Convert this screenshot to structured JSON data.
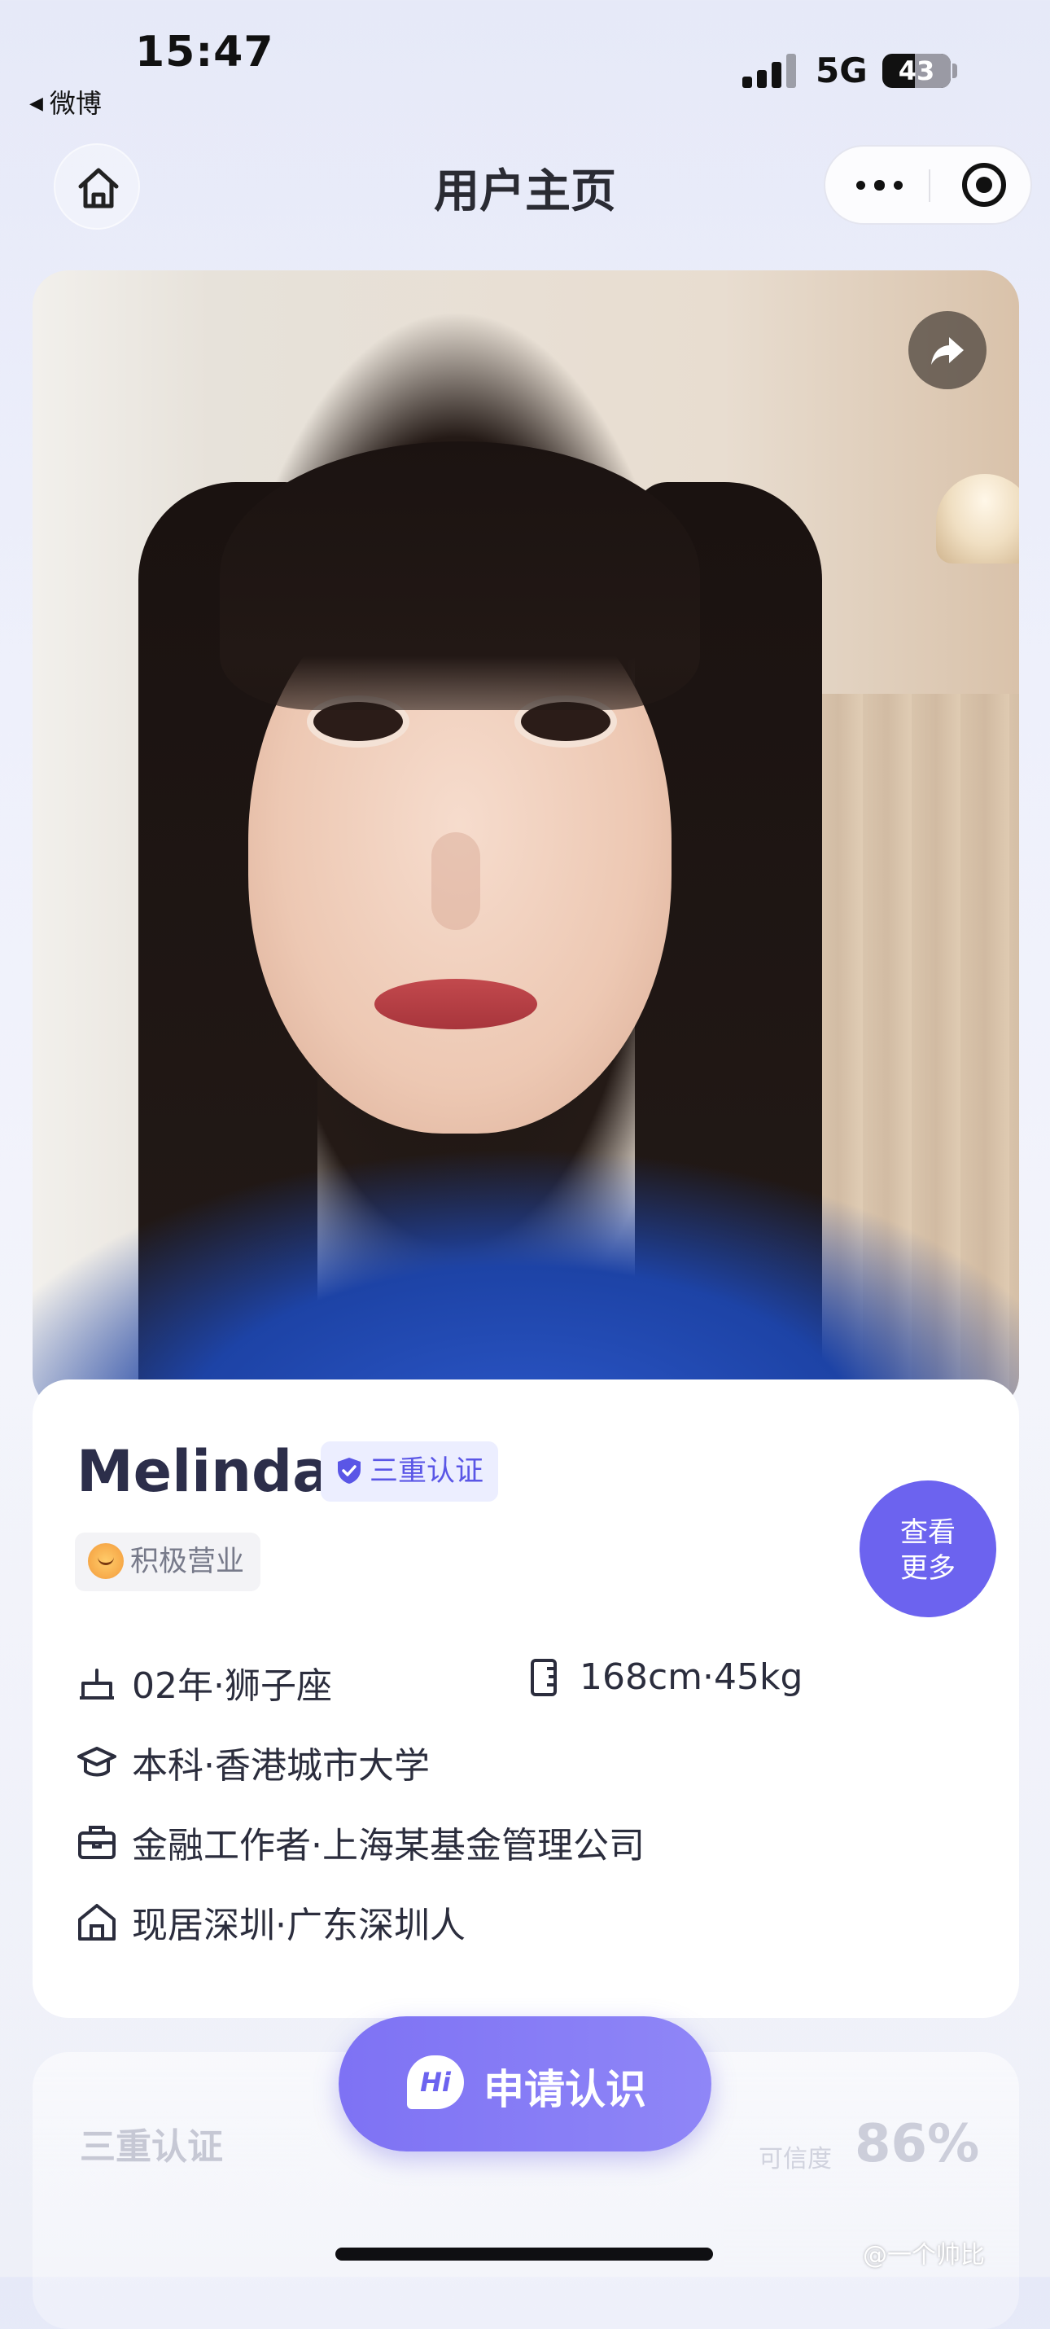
{
  "status_bar": {
    "time": "15:47",
    "back_app": "微博",
    "network": "5G",
    "battery": "43",
    "battery_level": 0.43
  },
  "nav": {
    "title": "用户主页",
    "home_icon": "home-icon",
    "more_icon": "more-dots-icon",
    "close_icon": "miniprogram-close-icon"
  },
  "photo": {
    "share_icon": "share-arrow-icon"
  },
  "profile": {
    "name": "Melinda",
    "verify_badge": "三重认证",
    "status_tag": "积极营业",
    "more_button_line1": "查看",
    "more_button_line2": "更多",
    "birth": "02年·狮子座",
    "body": "168cm·45kg",
    "education": "本科·香港城市大学",
    "job": "金融工作者·上海某基金管理公司",
    "residence": "现居深圳·广东深圳人"
  },
  "certification": {
    "title": "三重认证",
    "trust_label": "可信度",
    "trust_value": "86%"
  },
  "apply": {
    "hi_badge": "Hi",
    "label": "申请认识"
  },
  "watermark": "@一个帅比",
  "colors": {
    "accent": "#6c63ef",
    "badge_bg": "#eceeff",
    "badge_text": "#5a56e6"
  }
}
